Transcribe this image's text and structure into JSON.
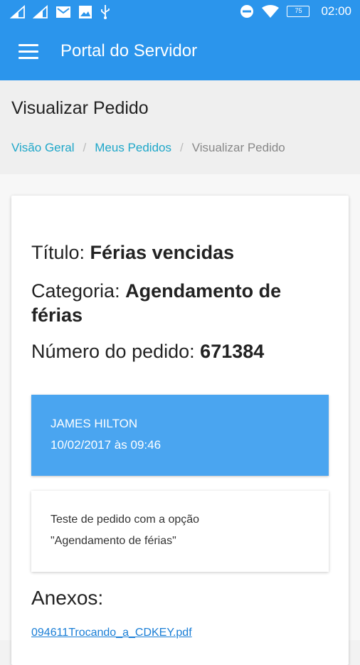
{
  "status_bar": {
    "time": "02:00",
    "battery": "75",
    "icons": [
      "signal-icon",
      "signal-icon",
      "gmail-icon",
      "image-icon",
      "usb-icon",
      "do-not-disturb-icon",
      "wifi-icon",
      "battery-icon"
    ]
  },
  "app_bar": {
    "title": "Portal do Servidor",
    "menu_icon": "hamburger-menu-icon"
  },
  "page": {
    "title": "Visualizar Pedido",
    "breadcrumb": [
      {
        "label": "Visão Geral"
      },
      {
        "label": "Meus Pedidos"
      },
      {
        "label": "Visualizar Pedido"
      }
    ],
    "breadcrumb_separator": "/"
  },
  "request": {
    "title_label": "Título:",
    "title_value": "Férias vencidas",
    "category_label": "Categoria:",
    "category_value_line1": "Agendamento de",
    "category_value_line2": "férias",
    "number_label": "Número do pedido:",
    "number_value": "671384"
  },
  "message": {
    "author": "JAMES HILTON",
    "datetime": "10/02/2017 às 09:46",
    "text_line1": "Teste de pedido com a opção",
    "text_line2": "\"Agendamento de férias\""
  },
  "attachments": {
    "heading": "Anexos:",
    "files": [
      "094611Trocando_a_CDKEY.pdf"
    ]
  },
  "colors": {
    "primary": "#2b95ec",
    "message_box": "#4aa5f0",
    "breadcrumb_link": "#1ea7c9",
    "file_link": "#1a7ed6"
  }
}
